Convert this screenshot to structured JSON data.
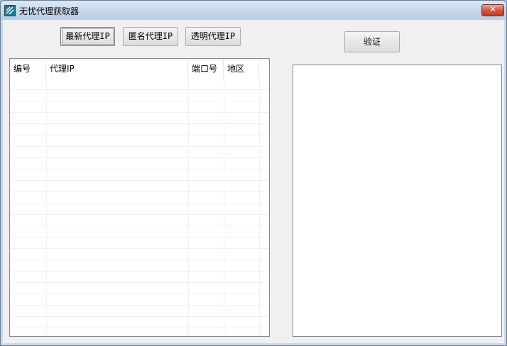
{
  "window": {
    "title": "无忧代理获取器",
    "close_glyph": "✕"
  },
  "toolbar": {
    "latest_label": "最新代理IP",
    "anonymous_label": "匿名代理IP",
    "transparent_label": "透明代理IP",
    "verify_label": "验证"
  },
  "proxy_table": {
    "columns": [
      "编号",
      "代理IP",
      "端口号",
      "地区"
    ],
    "rows": []
  },
  "result_box": {
    "value": ""
  }
}
